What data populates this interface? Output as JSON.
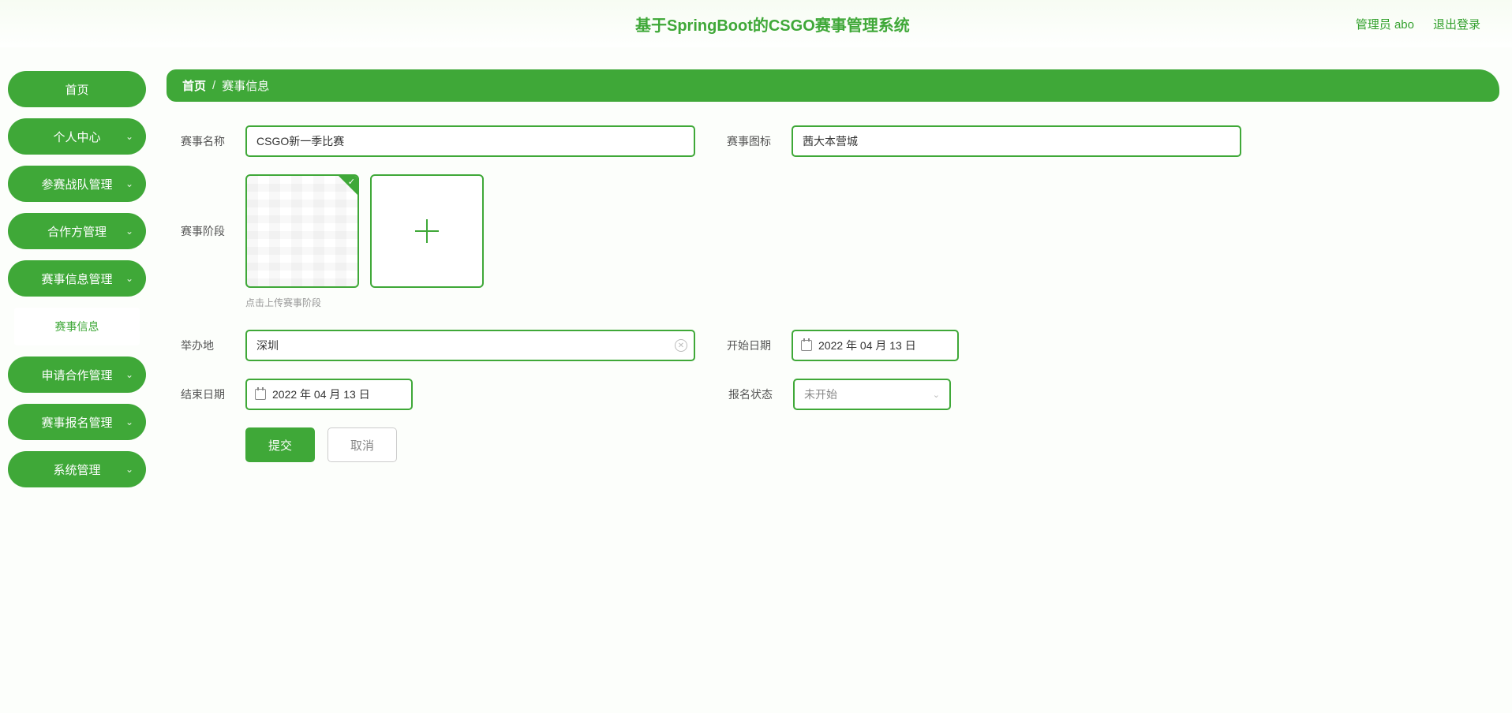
{
  "header": {
    "title": "基于SpringBoot的CSGO赛事管理系统",
    "admin_label": "管理员",
    "admin_name": "abo",
    "logout": "退出登录"
  },
  "sidebar": {
    "items": [
      {
        "label": "首页",
        "expandable": false
      },
      {
        "label": "个人中心",
        "expandable": true
      },
      {
        "label": "参赛战队管理",
        "expandable": true
      },
      {
        "label": "合作方管理",
        "expandable": true
      },
      {
        "label": "赛事信息管理",
        "expandable": true,
        "open": true,
        "sub": "赛事信息"
      },
      {
        "label": "申请合作管理",
        "expandable": true
      },
      {
        "label": "赛事报名管理",
        "expandable": true
      },
      {
        "label": "系统管理",
        "expandable": true
      }
    ]
  },
  "breadcrumb": {
    "home": "首页",
    "sep": "/",
    "current": "赛事信息"
  },
  "form": {
    "labels": {
      "name": "赛事名称",
      "icon": "赛事图标",
      "stage": "赛事阶段",
      "venue": "举办地",
      "start": "开始日期",
      "end": "结束日期",
      "status": "报名状态"
    },
    "values": {
      "name": "CSGO新一季比赛",
      "icon": "茜大本营城",
      "venue": "深圳",
      "start": "2022 年 04 月 13 日",
      "end": "2022 年 04 月 13 日",
      "status": "未开始"
    },
    "hint": "点击上传赛事阶段",
    "buttons": {
      "submit": "提交",
      "cancel": "取消"
    }
  }
}
